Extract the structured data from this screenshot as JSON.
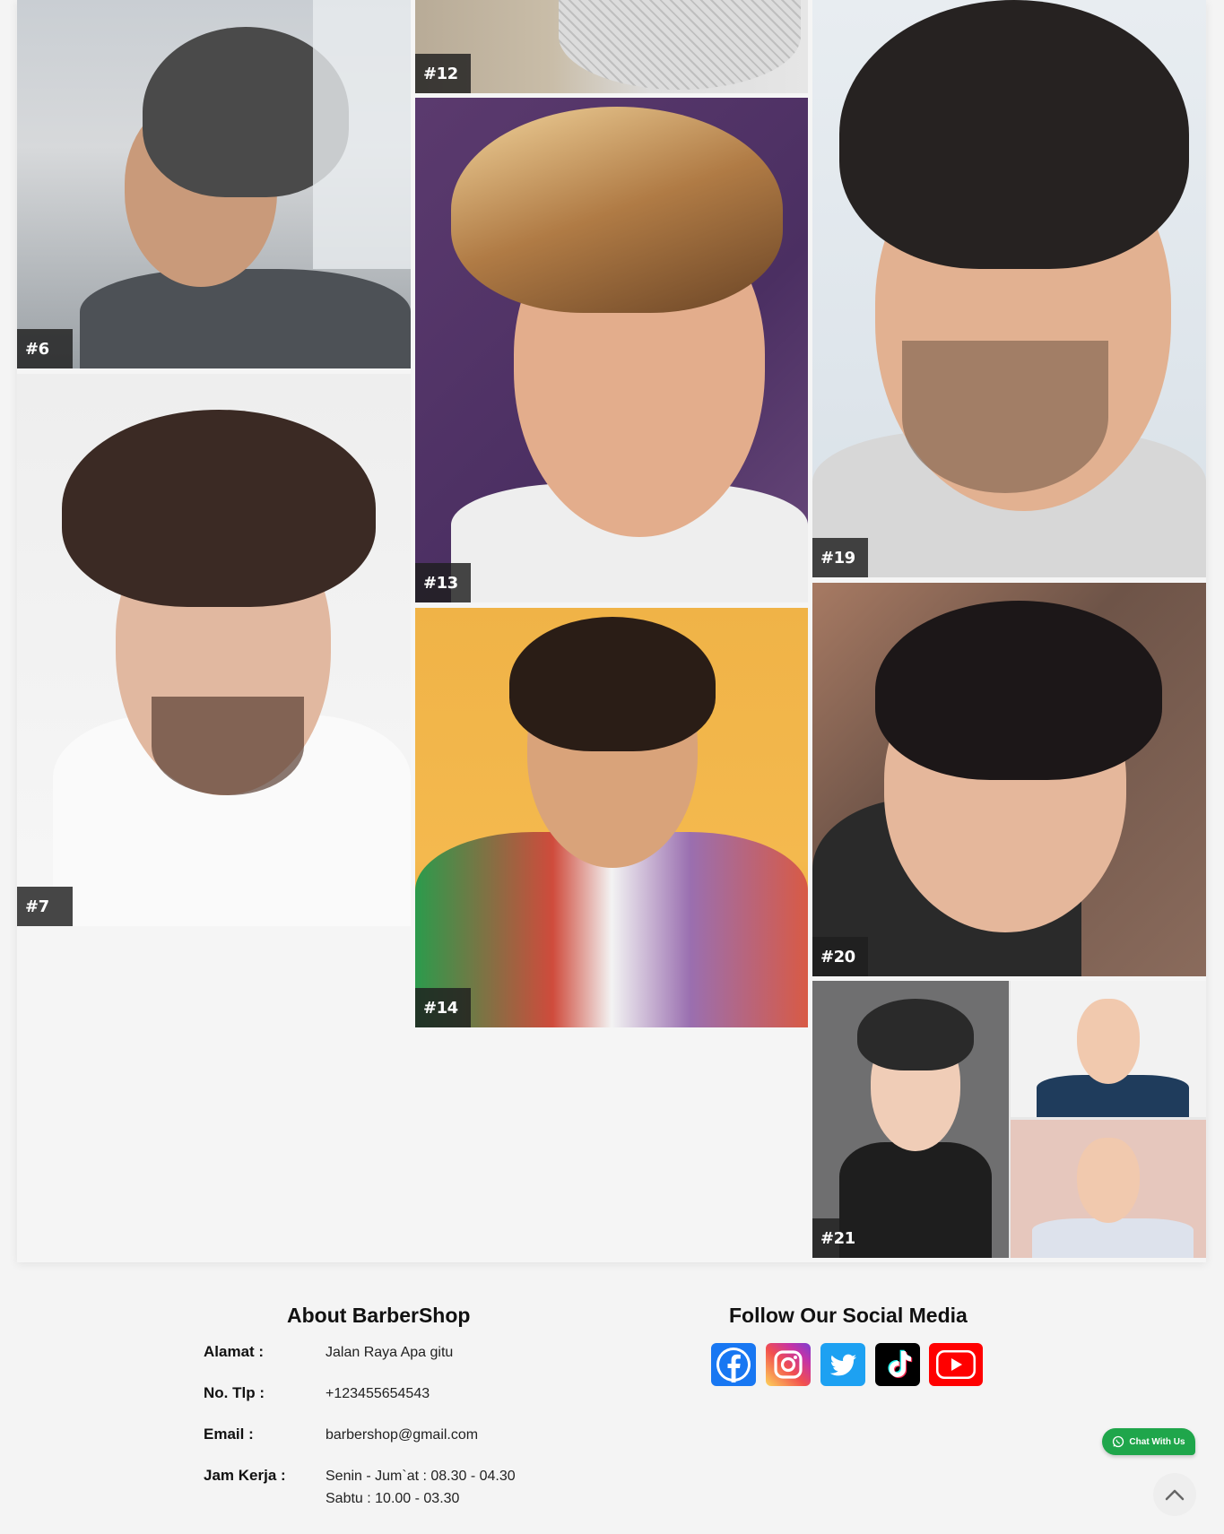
{
  "gallery": {
    "tiles": [
      {
        "label": "#6"
      },
      {
        "label": "#7"
      },
      {
        "label": "#12"
      },
      {
        "label": "#13"
      },
      {
        "label": "#14"
      },
      {
        "label": "#19"
      },
      {
        "label": "#20"
      },
      {
        "label": "#21"
      }
    ]
  },
  "footer": {
    "about_title": "About BarberShop",
    "social_title": "Follow Our Social Media",
    "info": [
      {
        "key": "Alamat :",
        "value": "Jalan Raya Apa gitu"
      },
      {
        "key": "No. Tlp :",
        "value": "+123455654543"
      },
      {
        "key": "Email :",
        "value": "barbershop@gmail.com"
      },
      {
        "key": "Jam Kerja :",
        "value_lines": [
          "Senin - Jum`at : 08.30 - 04.30",
          "Sabtu : 10.00 - 03.30"
        ]
      }
    ],
    "social": [
      {
        "name": "facebook",
        "icon": "facebook-icon",
        "color": "#1877f2"
      },
      {
        "name": "instagram",
        "icon": "instagram-icon",
        "color": "#e1306c"
      },
      {
        "name": "twitter",
        "icon": "twitter-icon",
        "color": "#1da1f2"
      },
      {
        "name": "tiktok",
        "icon": "tiktok-icon",
        "color": "#000000"
      },
      {
        "name": "youtube",
        "icon": "youtube-icon",
        "color": "#ff0000"
      }
    ]
  },
  "chat_button": {
    "label": "Chat With Us",
    "color": "#1fa64b"
  },
  "back_to_top": {
    "icon": "chevron-up-icon"
  }
}
